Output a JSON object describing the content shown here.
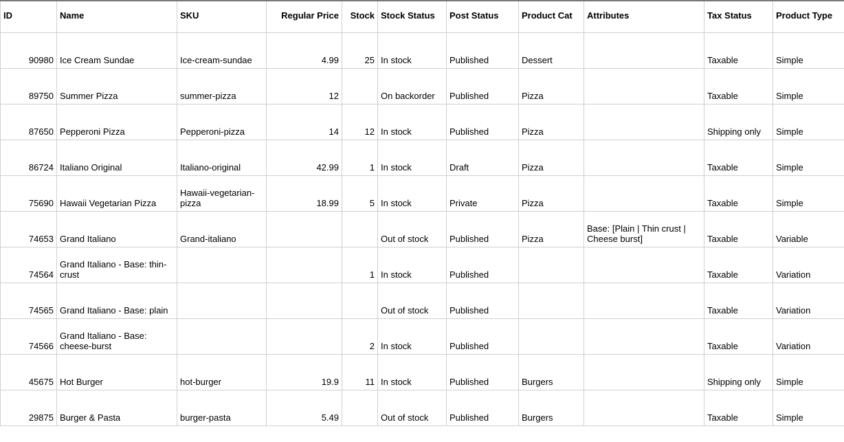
{
  "headers": {
    "id": "ID",
    "name": "Name",
    "sku": "SKU",
    "regular_price": "Regular Price",
    "stock": "Stock",
    "stock_status": "Stock Status",
    "post_status": "Post Status",
    "product_cat": "Product Cat",
    "attributes": "Attributes",
    "tax_status": "Tax Status",
    "product_type": "Product Type"
  },
  "rows": [
    {
      "id": "90980",
      "name": "Ice Cream Sundae",
      "sku": "Ice-cream-sundae",
      "regular_price": "4.99",
      "stock": "25",
      "stock_status": "In stock",
      "post_status": "Published",
      "product_cat": "Dessert",
      "attributes": "",
      "tax_status": "Taxable",
      "product_type": "Simple"
    },
    {
      "id": "89750",
      "name": "Summer Pizza",
      "sku": "summer-pizza",
      "regular_price": "12",
      "stock": "",
      "stock_status": "On backorder",
      "post_status": "Published",
      "product_cat": "Pizza",
      "attributes": "",
      "tax_status": "Taxable",
      "product_type": "Simple"
    },
    {
      "id": "87650",
      "name": "Pepperoni Pizza",
      "sku": "Pepperoni-pizza",
      "regular_price": "14",
      "stock": "12",
      "stock_status": "In stock",
      "post_status": "Published",
      "product_cat": "Pizza",
      "attributes": "",
      "tax_status": "Shipping only",
      "product_type": "Simple"
    },
    {
      "id": "86724",
      "name": "Italiano Original",
      "sku": "Italiano-original",
      "regular_price": "42.99",
      "stock": "1",
      "stock_status": "In stock",
      "post_status": "Draft",
      "product_cat": "Pizza",
      "attributes": "",
      "tax_status": "Taxable",
      "product_type": "Simple"
    },
    {
      "id": "75690",
      "name": "Hawaii Vegetarian Pizza",
      "sku": "Hawaii-vegetarian-pizza",
      "regular_price": "18.99",
      "stock": "5",
      "stock_status": "In stock",
      "post_status": "Private",
      "product_cat": "Pizza",
      "attributes": "",
      "tax_status": "Taxable",
      "product_type": "Simple"
    },
    {
      "id": "74653",
      "name": "Grand Italiano",
      "sku": "Grand-italiano",
      "regular_price": "",
      "stock": "",
      "stock_status": "Out of stock",
      "post_status": "Published",
      "product_cat": "Pizza",
      "attributes": "Base: [Plain | Thin crust | Cheese burst]",
      "tax_status": "Taxable",
      "product_type": "Variable"
    },
    {
      "id": "74564",
      "name": "Grand Italiano - Base: thin-crust",
      "sku": "",
      "regular_price": "",
      "stock": "1",
      "stock_status": "In stock",
      "post_status": "Published",
      "product_cat": "",
      "attributes": "",
      "tax_status": "Taxable",
      "product_type": "Variation"
    },
    {
      "id": "74565",
      "name": "Grand Italiano - Base: plain",
      "sku": "",
      "regular_price": "",
      "stock": "",
      "stock_status": "Out of stock",
      "post_status": "Published",
      "product_cat": "",
      "attributes": "",
      "tax_status": "Taxable",
      "product_type": "Variation"
    },
    {
      "id": "74566",
      "name": "Grand Italiano - Base: cheese-burst",
      "sku": "",
      "regular_price": "",
      "stock": "2",
      "stock_status": "In stock",
      "post_status": "Published",
      "product_cat": "",
      "attributes": "",
      "tax_status": "Taxable",
      "product_type": "Variation"
    },
    {
      "id": "45675",
      "name": "Hot Burger",
      "sku": "hot-burger",
      "regular_price": "19.9",
      "stock": "11",
      "stock_status": "In stock",
      "post_status": "Published",
      "product_cat": "Burgers",
      "attributes": "",
      "tax_status": "Shipping only",
      "product_type": "Simple"
    },
    {
      "id": "29875",
      "name": "Burger & Pasta",
      "sku": "burger-pasta",
      "regular_price": "5.49",
      "stock": "",
      "stock_status": "Out of stock",
      "post_status": "Published",
      "product_cat": "Burgers",
      "attributes": "",
      "tax_status": "Taxable",
      "product_type": "Simple"
    }
  ]
}
